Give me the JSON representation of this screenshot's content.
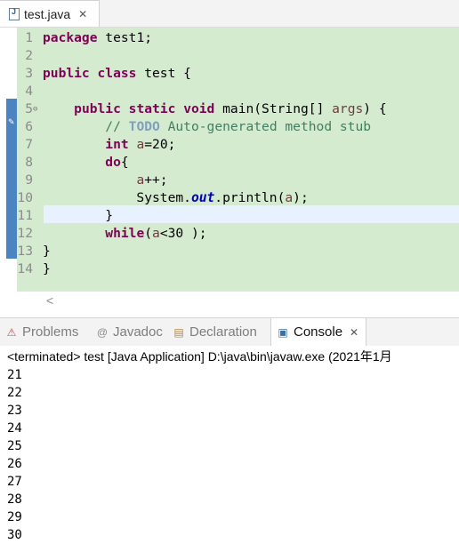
{
  "editor_tab": {
    "title": "test.java",
    "close": "✕"
  },
  "code_lines": [
    {
      "num": "1",
      "parts": [
        [
          "kw",
          "package"
        ],
        [
          "txt",
          " test1;"
        ]
      ]
    },
    {
      "num": "2",
      "parts": []
    },
    {
      "num": "3",
      "parts": [
        [
          "kw",
          "public"
        ],
        [
          "txt",
          " "
        ],
        [
          "kw",
          "class"
        ],
        [
          "txt",
          " test {"
        ]
      ]
    },
    {
      "num": "4",
      "parts": []
    },
    {
      "num": "5",
      "fold": "⊖",
      "parts": [
        [
          "txt",
          "    "
        ],
        [
          "kw",
          "public"
        ],
        [
          "txt",
          " "
        ],
        [
          "kw",
          "static"
        ],
        [
          "txt",
          " "
        ],
        [
          "kw",
          "void"
        ],
        [
          "txt",
          " main(String[] "
        ],
        [
          "var",
          "args"
        ],
        [
          "txt",
          ") {"
        ]
      ]
    },
    {
      "num": "6",
      "parts": [
        [
          "txt",
          "        "
        ],
        [
          "cm",
          "// "
        ],
        [
          "todo",
          "TODO"
        ],
        [
          "cm",
          " Auto-generated method stub"
        ]
      ]
    },
    {
      "num": "7",
      "parts": [
        [
          "txt",
          "        "
        ],
        [
          "kw",
          "int"
        ],
        [
          "txt",
          " "
        ],
        [
          "var",
          "a"
        ],
        [
          "txt",
          "=20;"
        ]
      ]
    },
    {
      "num": "8",
      "parts": [
        [
          "txt",
          "        "
        ],
        [
          "kw",
          "do"
        ],
        [
          "txt",
          "{"
        ]
      ]
    },
    {
      "num": "9",
      "parts": [
        [
          "txt",
          "            "
        ],
        [
          "var",
          "a"
        ],
        [
          "txt",
          "++;"
        ]
      ]
    },
    {
      "num": "10",
      "parts": [
        [
          "txt",
          "            System."
        ],
        [
          "fld",
          "out"
        ],
        [
          "txt",
          ".println("
        ],
        [
          "var",
          "a"
        ],
        [
          "txt",
          ");"
        ]
      ]
    },
    {
      "num": "11",
      "parts": [
        [
          "txt",
          "        }"
        ]
      ]
    },
    {
      "num": "12",
      "parts": [
        [
          "txt",
          "        "
        ],
        [
          "kw",
          "while"
        ],
        [
          "txt",
          "("
        ],
        [
          "var",
          "a"
        ],
        [
          "txt",
          "<30 );"
        ]
      ]
    },
    {
      "num": "13",
      "parts": [
        [
          "txt",
          "}"
        ]
      ]
    },
    {
      "num": "14",
      "parts": [
        [
          "txt",
          "}"
        ]
      ]
    }
  ],
  "hscroll_arrow": "<",
  "views": {
    "problems": {
      "label": "Problems",
      "icon": "problems-icon"
    },
    "javadoc": {
      "label": "Javadoc",
      "icon": "javadoc-icon"
    },
    "declaration": {
      "label": "Declaration",
      "icon": "declaration-icon"
    },
    "console": {
      "label": "Console",
      "icon": "console-icon",
      "close": "✕"
    }
  },
  "console": {
    "status": "<terminated> test [Java Application] D:\\java\\bin\\javaw.exe (2021年1月",
    "output": [
      "21",
      "22",
      "23",
      "24",
      "25",
      "26",
      "27",
      "28",
      "29",
      "30"
    ]
  },
  "colors": {
    "keyword": "#7f0055",
    "comment": "#3f7f5f",
    "field": "#0000c0",
    "code_background": "#d5ebd0",
    "current_line": "#e8f2fe"
  }
}
